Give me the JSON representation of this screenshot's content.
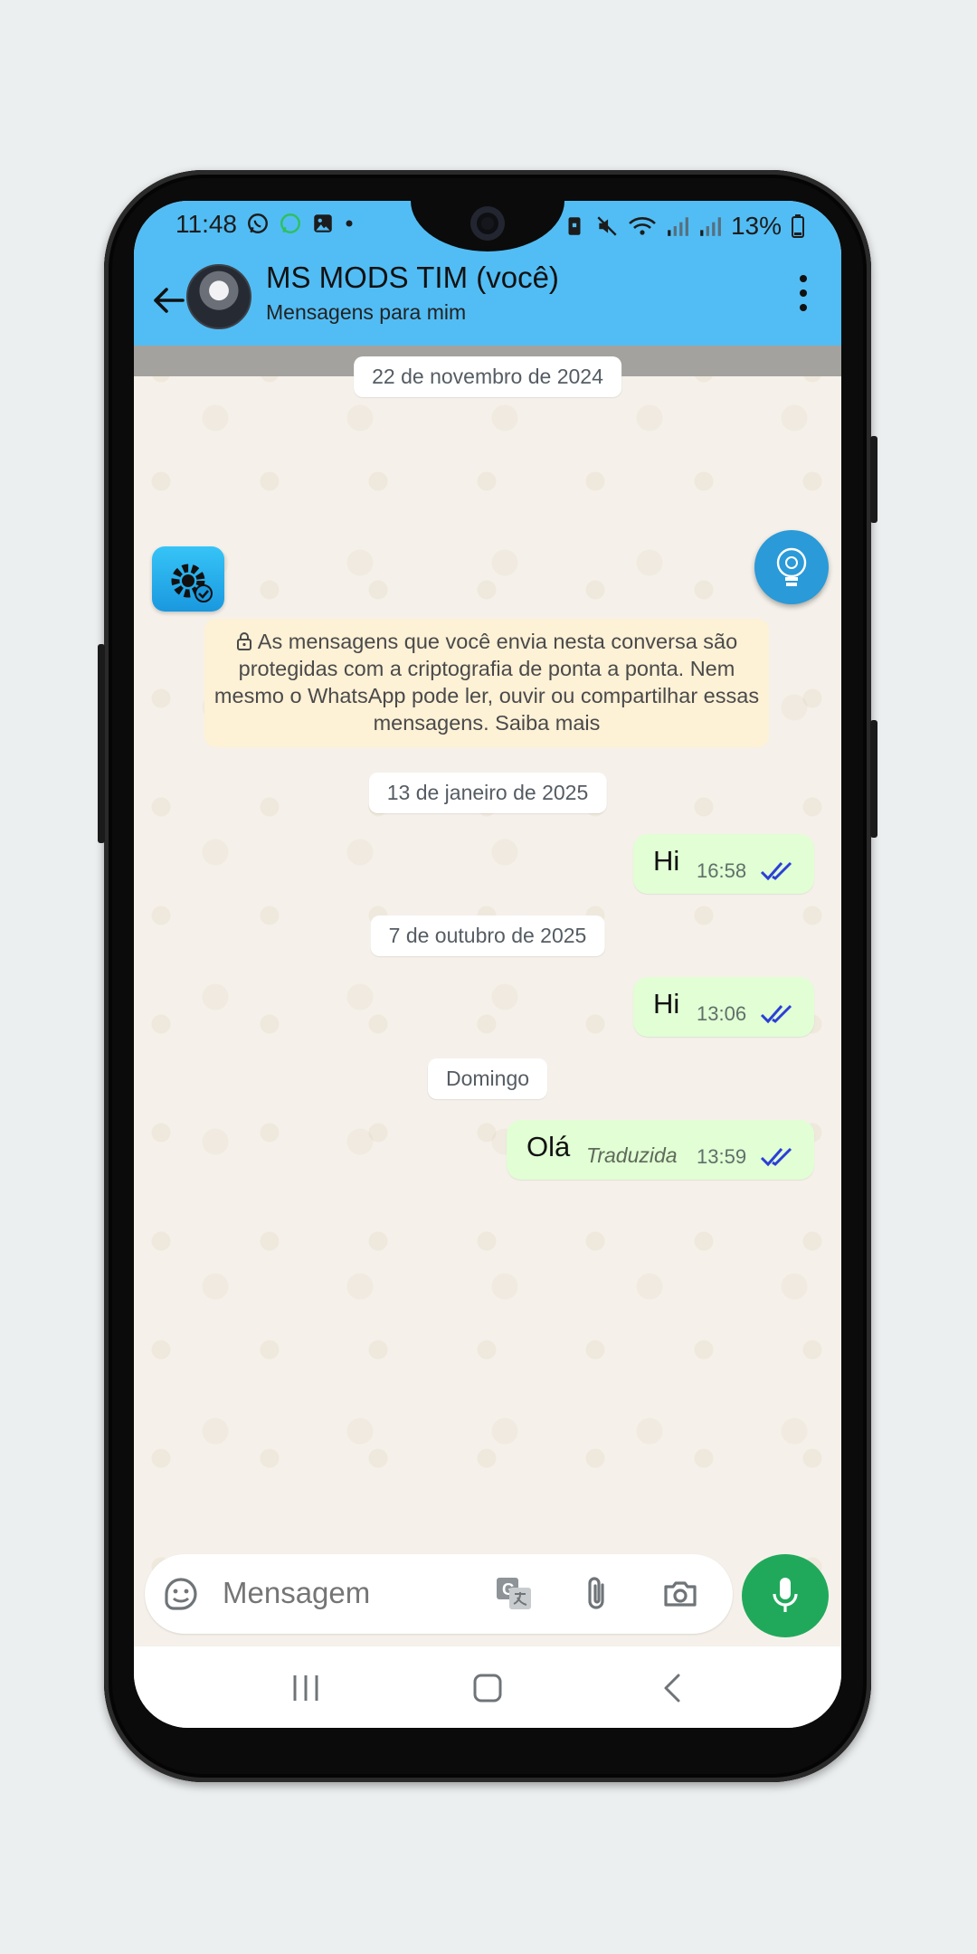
{
  "status_bar": {
    "time": "11:48",
    "battery": "13%"
  },
  "header": {
    "contact_name": "MS MODS TIM (você)",
    "subtitle": "Mensagens para mim"
  },
  "chat": {
    "encryption_date": "22 de novembro de 2024",
    "encryption_notice": "As mensagens que você envia nesta conversa são protegidas com a criptografia de ponta a ponta. Nem mesmo o WhatsApp pode ler, ouvir ou compartilhar essas mensagens. Saiba mais",
    "groups": [
      {
        "date": "13 de janeiro de 2025",
        "text": "Hi",
        "time": "16:58"
      },
      {
        "date": "7 de outubro de 2025",
        "text": "Hi",
        "time": "13:06"
      },
      {
        "date": "Domingo",
        "text": "Olá",
        "translated_label": "Traduzida",
        "time": "13:59"
      }
    ]
  },
  "composer": {
    "placeholder": "Mensagem"
  },
  "colors": {
    "header": "#52bdf4",
    "outgoing_bubble": "#e1fed4",
    "read_ticks": "#2b3fd6",
    "mic_button": "#21a95b",
    "encryption_note": "#fdf1d6"
  }
}
